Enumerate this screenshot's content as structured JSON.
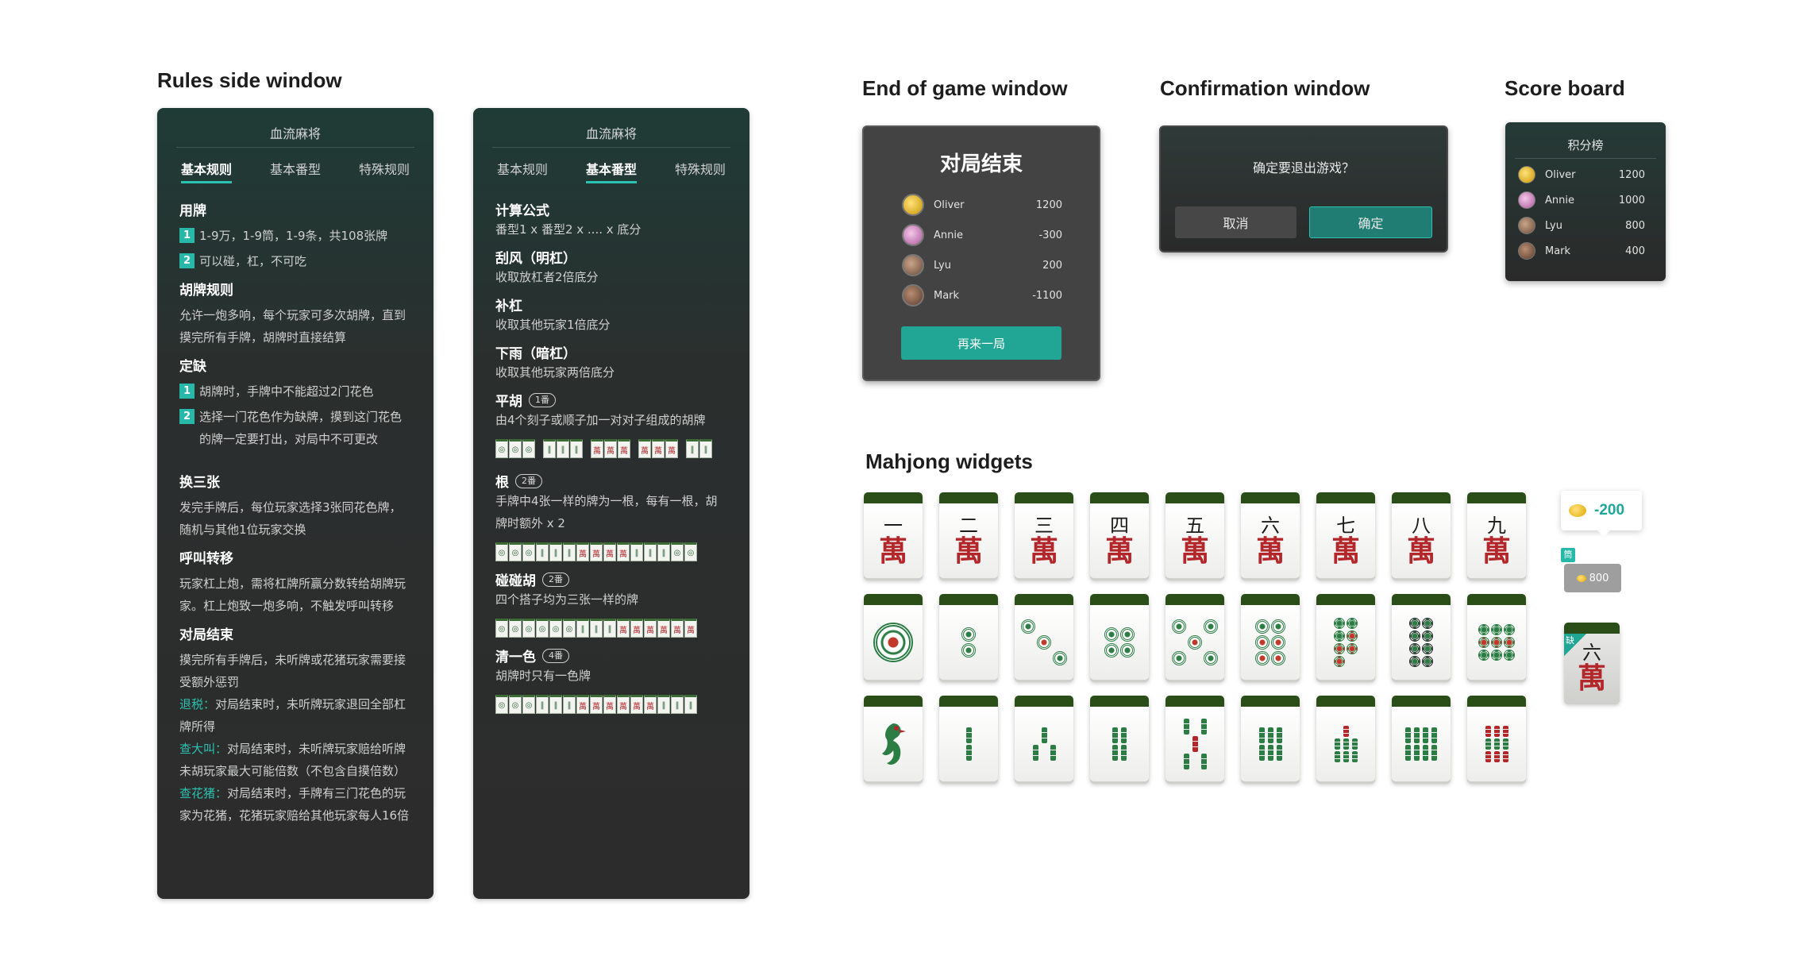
{
  "headings": {
    "rules": "Rules side window",
    "end_of_game": "End of game window",
    "confirmation": "Confirmation window",
    "score_board": "Score board",
    "widgets": "Mahjong widgets"
  },
  "rules_panel_1": {
    "title": "血流麻将",
    "tabs": [
      "基本规则",
      "基本番型",
      "特殊规则"
    ],
    "s1_title": "用牌",
    "s1_i1": "1-9万，1-9筒，1-9条，共108张牌",
    "s1_i2": "可以碰，杠，不可吃",
    "s2_title": "胡牌规则",
    "s2_text": "允许一炮多响，每个玩家可多次胡牌，直到摸完所有手牌，胡牌时直接结算",
    "s3_title": "定缺",
    "s3_i1": "胡牌时，手牌中不能超过2门花色",
    "s3_i2": "选择一门花色作为缺牌，摸到这门花色的牌一定要打出，对局中不可更改",
    "s4_title": "换三张",
    "s4_text": "发完手牌后，每位玩家选择3张同花色牌，随机与其他1位玩家交换",
    "s5_title": "呼叫转移",
    "s5_text": "玩家杠上炮，需将杠牌所赢分数转给胡牌玩家。杠上炮致一炮多响，不触发呼叫转移",
    "s6_title": "对局结束",
    "s6_text": "摸完所有手牌后，未听牌或花猪玩家需要接受额外惩罚",
    "s6_t1_label": "退税：",
    "s6_t1": "对局结束时，未听牌玩家退回全部杠牌所得",
    "s6_t2_label": "查大叫：",
    "s6_t2": "对局结束时，未听牌玩家赔给听牌未胡玩家最大可能倍数（不包含自摸倍数）",
    "s6_t3_label": "查花猪：",
    "s6_t3": "对局结束时，手牌有三门花色的玩家为花猪，花猪玩家赔给其他玩家每人16倍"
  },
  "rules_panel_2": {
    "title": "血流麻将",
    "tabs": [
      "基本规则",
      "基本番型",
      "特殊规则"
    ],
    "f1_title": "计算公式",
    "f1_text": "番型1 x 番型2 x .... x 底分",
    "f2_title": "刮风（明杠）",
    "f2_text": "收取放杠者2倍底分",
    "f3_title": "补杠",
    "f3_text": "收取其他玩家1倍底分",
    "f4_title": "下雨（暗杠）",
    "f4_text": "收取其他玩家两倍底分",
    "f5_title": "平胡",
    "f5_badge": "1番",
    "f5_text": "由4个刻子或顺子加一对对子组成的胡牌",
    "f6_title": "根",
    "f6_badge": "2番",
    "f6_text": "手牌中4张一样的牌为一根，每有一根，胡牌时额外 x 2",
    "f7_title": "碰碰胡",
    "f7_badge": "2番",
    "f7_text": "四个搭子均为三张一样的牌",
    "f8_title": "清一色",
    "f8_badge": "4番",
    "f8_text": "胡牌时只有一色牌"
  },
  "end_of_game": {
    "title": "对局结束",
    "players": [
      {
        "name": "Oliver",
        "score": "1200"
      },
      {
        "name": "Annie",
        "score": "-300"
      },
      {
        "name": "Lyu",
        "score": "200"
      },
      {
        "name": "Mark",
        "score": "-1100"
      }
    ],
    "button": "再来一局"
  },
  "confirmation": {
    "question": "确定要退出游戏？",
    "cancel": "取消",
    "ok": "确定"
  },
  "score_board": {
    "title": "积分榜",
    "players": [
      {
        "name": "Oliver",
        "score": "1200"
      },
      {
        "name": "Annie",
        "score": "1000"
      },
      {
        "name": "Lyu",
        "score": "800"
      },
      {
        "name": "Mark",
        "score": "400"
      }
    ]
  },
  "widgets": {
    "wan_numbers": [
      "一",
      "二",
      "三",
      "四",
      "五",
      "六",
      "七",
      "八",
      "九"
    ],
    "wan_char": "萬",
    "score_delta": "-200",
    "bank_tag": "筒",
    "score_chip": "800",
    "que_tag": "缺",
    "que_tile_num": "六",
    "que_tile_char": "萬"
  },
  "colors": {
    "accent": "#26b8a8",
    "tile_back": "#2b4d18",
    "wan_red": "#b3262a",
    "bamboo_green": "#2c7d44"
  }
}
